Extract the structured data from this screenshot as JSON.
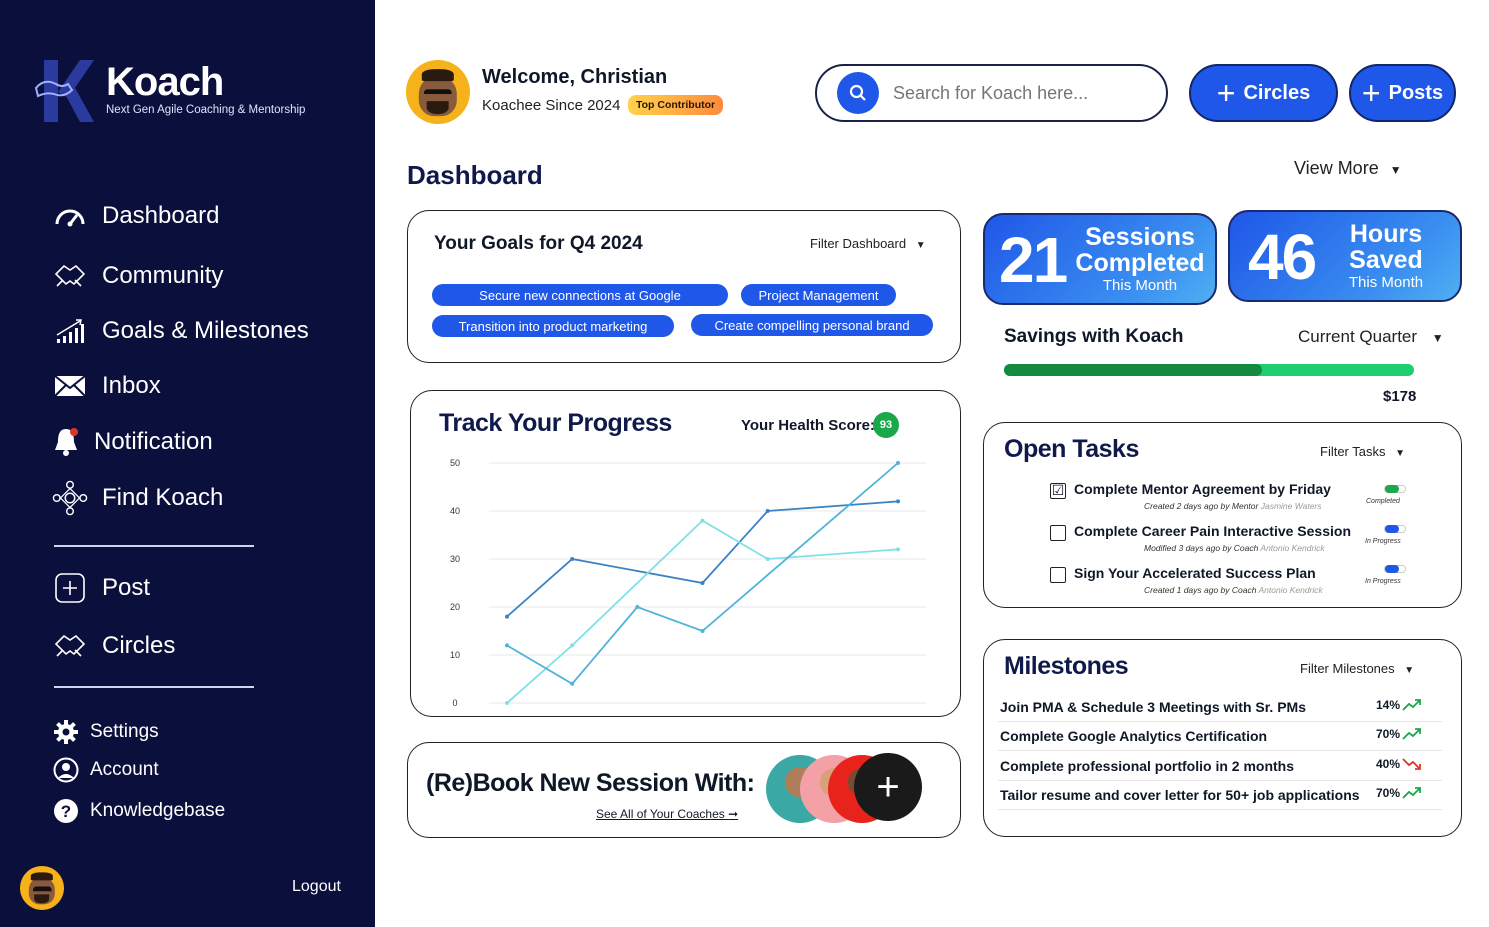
{
  "brand": {
    "name": "Koach",
    "tagline": "Next Gen Agile Coaching & Mentorship"
  },
  "sidebar": {
    "items": [
      {
        "label": "Dashboard",
        "icon": "gauge-icon"
      },
      {
        "label": "Community",
        "icon": "handshake-icon"
      },
      {
        "label": "Goals & Milestones",
        "icon": "growth-chart-icon"
      },
      {
        "label": "Inbox",
        "icon": "mail-icon"
      },
      {
        "label": "Notification",
        "icon": "bell-icon"
      },
      {
        "label": "Find Koach",
        "icon": "network-icon"
      }
    ],
    "actions": [
      {
        "label": "Post",
        "icon": "plus-square-icon"
      },
      {
        "label": "Circles",
        "icon": "handshake-icon"
      }
    ],
    "footer_items": [
      {
        "label": "Settings",
        "icon": "gear-icon"
      },
      {
        "label": "Account",
        "icon": "user-circle-icon"
      },
      {
        "label": "Knowledgebase",
        "icon": "help-circle-icon"
      }
    ],
    "logout_label": "Logout"
  },
  "header": {
    "welcome": "Welcome, Christian",
    "since": "Koachee Since 2024",
    "badge": "Top Contributor",
    "search_placeholder": "Search for Koach here...",
    "circles_label": "Circles",
    "posts_label": "Posts"
  },
  "dashboard": {
    "title": "Dashboard",
    "view_more": "View More"
  },
  "goals": {
    "title": "Your Goals for Q4 2024",
    "filter": "Filter Dashboard",
    "chips": [
      "Secure new connections at Google",
      "Project Management",
      "Transition into product marketing",
      "Create compelling personal brand"
    ]
  },
  "stats": [
    {
      "value": "21",
      "label_top": "Sessions",
      "label_bottom": "Completed",
      "period": "This Month"
    },
    {
      "value": "46",
      "label_top": "Hours",
      "label_bottom": "Saved",
      "period": "This Month"
    }
  ],
  "savings": {
    "title": "Savings with Koach",
    "filter": "Current Quarter",
    "amount": "$178",
    "progress": 0.63
  },
  "progress": {
    "title": "Track Your Progress",
    "health_label": "Your Health Score:",
    "health_score": "93"
  },
  "chart_data": {
    "type": "line",
    "title": "Track Your Progress",
    "ylim": [
      0,
      50
    ],
    "yticks": [
      "0",
      "10",
      "20",
      "30",
      "40",
      "50"
    ],
    "x": [
      1,
      2,
      3,
      4,
      5,
      6,
      7
    ],
    "series": [
      {
        "values": [
          18,
          30,
          25,
          40,
          42
        ],
        "x": [
          1,
          2,
          4,
          5,
          7
        ],
        "color": "#3b82c4"
      },
      {
        "values": [
          0,
          12,
          38,
          30,
          32
        ],
        "x": [
          1,
          2,
          4,
          5,
          7
        ],
        "color": "#7fe0e6"
      },
      {
        "values": [
          12,
          4,
          20,
          15,
          50
        ],
        "x": [
          1,
          2,
          3,
          4,
          7
        ],
        "color": "#4fb3d9"
      }
    ]
  },
  "rebook": {
    "title": "(Re)Book New Session With:",
    "link": "See All of Your Coaches"
  },
  "tasks": {
    "title": "Open Tasks",
    "filter": "Filter Tasks",
    "items": [
      {
        "title": "Complete Mentor Agreement by Friday",
        "meta_prefix": "Created 2 days ago  by  Mentor",
        "meta_name": "Jasmine Waters",
        "status": "Completed",
        "checked": "☑",
        "state": "done"
      },
      {
        "title": "Complete Career Pain Interactive Session",
        "meta_prefix": "Modified 3 days ago  by  Coach",
        "meta_name": "Antonio Kendrick",
        "status": "In Progress",
        "checked": "",
        "state": "progress"
      },
      {
        "title": "Sign Your Accelerated Success Plan",
        "meta_prefix": "Created  1 days ago  by  Coach",
        "meta_name": "Antonio Kendrick",
        "status": "In Progress",
        "checked": "",
        "state": "progress"
      }
    ]
  },
  "milestones": {
    "title": "Milestones",
    "filter": "Filter Milestones",
    "items": [
      {
        "title": "Join PMA & Schedule 3 Meetings with Sr. PMs",
        "pct": "14%",
        "trend": "up"
      },
      {
        "title": "Complete Google Analytics Certification",
        "pct": "70%",
        "trend": "up"
      },
      {
        "title": "Complete professional portfolio in 2 months",
        "pct": "40%",
        "trend": "down"
      },
      {
        "title": "Tailor resume and cover letter for 50+ job applications",
        "pct": "70%",
        "trend": "up"
      }
    ]
  },
  "colors": {
    "sidebar": "#0b0f3b",
    "accent": "#1f57e8",
    "success": "#1aa84a",
    "danger": "#e0342b"
  }
}
